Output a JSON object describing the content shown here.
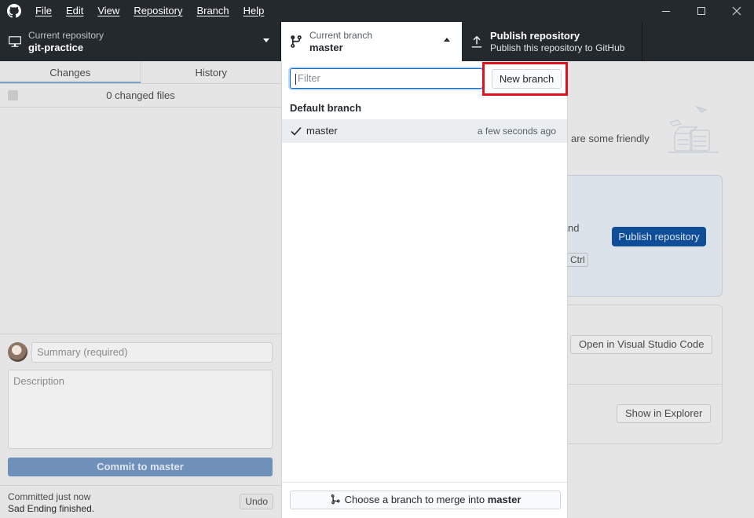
{
  "titlebar": {
    "logo_icon": "github-octocat-icon",
    "menu": [
      "File",
      "Edit",
      "View",
      "Repository",
      "Branch",
      "Help"
    ],
    "controls": [
      "minimize-icon",
      "maximize-icon",
      "close-icon"
    ]
  },
  "toolbar": {
    "repository": {
      "label": "Current repository",
      "value": "git-practice",
      "icon": "desktop-icon"
    },
    "branch": {
      "label": "Current branch",
      "value": "master",
      "icon": "git-branch-icon"
    },
    "publish": {
      "label": "Publish repository",
      "sublabel": "Publish this repository to GitHub",
      "icon": "upload-icon"
    }
  },
  "left_pane": {
    "tabs": [
      "Changes",
      "History"
    ],
    "active_tab": "Changes",
    "changed_files": "0 changed files",
    "summary_placeholder": "Summary (required)",
    "description_placeholder": "Description",
    "commit_button": {
      "prefix": "Commit to",
      "branch": "master"
    },
    "last_commit": {
      "time": "Committed just now",
      "message": "Sad Ending finished."
    },
    "undo_label": "Undo"
  },
  "right_pane": {
    "friendly_text_fragment": "are some friendly",
    "publish_text_fragment": "nd",
    "shortcut_fragment": "Ctrl",
    "publish_button": "Publish repository",
    "open_editor_button": "Open in Visual Studio Code",
    "show_explorer_button": "Show in Explorer"
  },
  "branch_dropdown": {
    "filter_placeholder": "Filter",
    "new_branch_label": "New branch",
    "highlight_color": "#e0121e",
    "section_header": "Default branch",
    "branches": [
      {
        "name": "master",
        "time": "a few seconds ago",
        "selected": true
      }
    ],
    "merge_button": {
      "prefix": "Choose a branch to merge into",
      "branch": "master"
    }
  }
}
